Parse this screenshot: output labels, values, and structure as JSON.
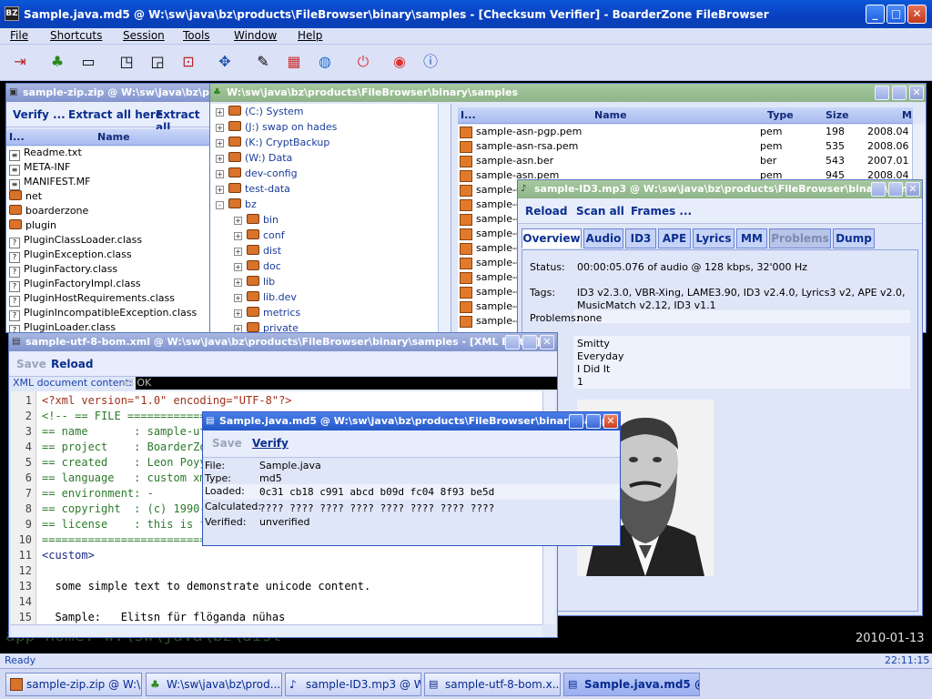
{
  "window_title": "Sample.java.md5 @ W:\\sw\\java\\bz\\products\\FileBrowser\\binary\\samples - [Checksum Verifier] - BoarderZone FileBrowser",
  "menu": [
    "File",
    "Shortcuts",
    "Session",
    "Tools",
    "Window",
    "Help"
  ],
  "toolbar_icons": [
    "exit-icon",
    "tree-icon",
    "window-icon",
    "window-cascade-icon",
    "window-tile-icon",
    "window-arrow-icon",
    "network-icon",
    "editor-icon",
    "grid-icon",
    "globe-icon",
    "power-icon",
    "lifebuoy-icon",
    "info-icon"
  ],
  "console": {
    "app_home": "app home: w:\\sw\\java\\bz\\dist",
    "date": "2010-01-13"
  },
  "status": {
    "text": "Ready",
    "time": "22:11:15"
  },
  "zip_window": {
    "title": "sample-zip.zip @ W:\\sw\\java\\bz\\products\\FileBrowser\\binary\\samples",
    "buttons": [
      "Verify ...",
      "Extract all here",
      "Extract all"
    ],
    "col_i": "I...",
    "col_name": "Name",
    "rows": [
      {
        "name": "Readme.txt",
        "icon": "text-file-icon"
      },
      {
        "name": "META-INF",
        "icon": "text-file-icon"
      },
      {
        "name": "MANIFEST.MF",
        "icon": "text-file-icon"
      },
      {
        "name": "net",
        "icon": "folder-icon"
      },
      {
        "name": "boarderzone",
        "icon": "folder-icon"
      },
      {
        "name": "plugin",
        "icon": "folder-icon"
      },
      {
        "name": "PluginClassLoader.class",
        "icon": "unknown-file-icon"
      },
      {
        "name": "PluginException.class",
        "icon": "unknown-file-icon"
      },
      {
        "name": "PluginFactory.class",
        "icon": "unknown-file-icon"
      },
      {
        "name": "PluginFactoryImpl.class",
        "icon": "unknown-file-icon"
      },
      {
        "name": "PluginHostRequirements.class",
        "icon": "unknown-file-icon"
      },
      {
        "name": "PluginIncompatibleException.class",
        "icon": "unknown-file-icon"
      },
      {
        "name": "PluginLoader.class",
        "icon": "unknown-file-icon"
      }
    ]
  },
  "browser_window": {
    "title": "W:\\sw\\java\\bz\\products\\FileBrowser\\binary\\samples",
    "tree": [
      {
        "label": "(C:) System",
        "level": 0,
        "exp": "+"
      },
      {
        "label": "(J:) swap on hades",
        "level": 0,
        "exp": "+"
      },
      {
        "label": "(K:) CryptBackup",
        "level": 0,
        "exp": "+"
      },
      {
        "label": "(W:) Data",
        "level": 0,
        "exp": "+"
      },
      {
        "label": "dev-config",
        "level": 0,
        "exp": "+"
      },
      {
        "label": "test-data",
        "level": 0,
        "exp": "+"
      },
      {
        "label": "bz",
        "level": 0,
        "exp": "-"
      },
      {
        "label": "bin",
        "level": 1,
        "exp": "+"
      },
      {
        "label": "conf",
        "level": 1,
        "exp": "+"
      },
      {
        "label": "dist",
        "level": 1,
        "exp": "+"
      },
      {
        "label": "doc",
        "level": 1,
        "exp": "+"
      },
      {
        "label": "lib",
        "level": 1,
        "exp": "+"
      },
      {
        "label": "lib.dev",
        "level": 1,
        "exp": "+"
      },
      {
        "label": "metrics",
        "level": 1,
        "exp": "+"
      },
      {
        "label": "private",
        "level": 1,
        "exp": "+"
      }
    ],
    "cols": {
      "i": "I...",
      "name": "Name",
      "type": "Type",
      "size": "Size",
      "m": "M"
    },
    "files": [
      {
        "name": "sample-asn-pgp.pem",
        "type": "pem",
        "size": "198",
        "mod": "2008.04"
      },
      {
        "name": "sample-asn-rsa.pem",
        "type": "pem",
        "size": "535",
        "mod": "2008.06"
      },
      {
        "name": "sample-asn.ber",
        "type": "ber",
        "size": "543",
        "mod": "2007.01"
      },
      {
        "name": "sample-asn.pem",
        "type": "pem",
        "size": "945",
        "mod": "2008.04"
      },
      {
        "name": "sample-c",
        "type": "",
        "size": "",
        "mod": ""
      },
      {
        "name": "sample-c",
        "type": "",
        "size": "",
        "mod": ""
      },
      {
        "name": "sample-c",
        "type": "",
        "size": "",
        "mod": ""
      },
      {
        "name": "sample-c",
        "type": "",
        "size": "",
        "mod": ""
      },
      {
        "name": "sample-c",
        "type": "",
        "size": "",
        "mod": ""
      },
      {
        "name": "sample-c",
        "type": "",
        "size": "",
        "mod": ""
      },
      {
        "name": "sample-d",
        "type": "",
        "size": "",
        "mod": ""
      },
      {
        "name": "sample-d",
        "type": "",
        "size": "",
        "mod": ""
      },
      {
        "name": "sample-d",
        "type": "",
        "size": "",
        "mod": ""
      },
      {
        "name": "sample-d",
        "type": "",
        "size": "",
        "mod": ""
      }
    ]
  },
  "id3_window": {
    "title": "sample-ID3.mp3 @ W:\\sw\\java\\bz\\products\\FileBrowser\\binary\\samp",
    "buttons": [
      "Reload",
      "Scan all",
      "Frames ..."
    ],
    "tabs": [
      "Overview",
      "Audio",
      "ID3",
      "APE",
      "Lyrics",
      "MM",
      "Problems",
      "Dump"
    ],
    "status_label": "Status:",
    "status_value": "00:00:05.076 of audio @ 128 kbps, 32'000 Hz",
    "tags_label": "Tags:",
    "tags_value_1": "ID3 v2.3.0, VBR-Xing, LAME3.90, ID3 v2.4.0, Lyrics3 v2, APE v2.0,",
    "tags_value_2": "MusicMatch v2.12, ID3 v1.1",
    "problems_label": "Problems:",
    "problems_value": "none",
    "track_lines": [
      "Smitty",
      "Everyday",
      "I Did It",
      "1"
    ]
  },
  "xml_window": {
    "title": "sample-utf-8-bom.xml @ W:\\sw\\java\\bz\\products\\FileBrowser\\binary\\samples - [XML Editor]",
    "save": "Save",
    "reload": "Reload",
    "content_label": "XML document content:",
    "content_status": "all OK",
    "lines": [
      "<?xml version=\"1.0\" encoding=\"UTF-8\"?>",
      "<!-- == FILE ===================",
      "== name       : sample-utf",
      "== project    : BoarderZon",
      "== created    : Leon Poyyo",
      "== language   : custom xml",
      "== environment: -",
      "== copyright  : (c) 1990-2",
      "== license    : this is fr",
      "==============================",
      "<custom>",
      "",
      "  some simple text to demonstrate unicode content.",
      "",
      "  Sample:   Elitsn für flöganda nühas"
    ]
  },
  "md5_window": {
    "title": "Sample.java.md5 @ W:\\sw\\java\\bz\\products\\FileBrowser\\binary\\sampl",
    "save": "Save",
    "verify": "Verify",
    "file_label": "File:",
    "file_value": "Sample.java",
    "type_label": "Type:",
    "type_value": "md5",
    "loaded_label": "Loaded:",
    "loaded_value": "0c31 cb18 c991 abcd b09d fc04 8f93 be5d",
    "calculated_label": "Calculated:",
    "calculated_value": "???? ???? ???? ???? ???? ???? ???? ????",
    "verified_label": "Verified:",
    "verified_value": "unverified"
  },
  "taskbar": [
    {
      "label": "sample-zip.zip @ W:\\...",
      "icon": "zip-icon"
    },
    {
      "label": "W:\\sw\\java\\bz\\prod...",
      "icon": "tree-icon"
    },
    {
      "label": "sample-ID3.mp3 @ W...",
      "icon": "music-note-icon"
    },
    {
      "label": "sample-utf-8-bom.x...",
      "icon": "xml-icon"
    },
    {
      "label": "Sample.java.md5 @ ...",
      "icon": "checksum-icon"
    }
  ]
}
